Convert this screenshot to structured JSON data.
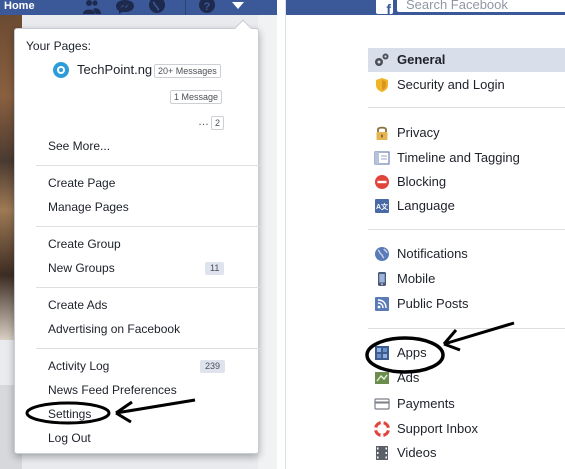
{
  "left": {
    "topbar": {
      "home_label": "Home"
    },
    "menu": {
      "your_pages_label": "Your Pages:",
      "page_name": "TechPoint.ng",
      "page_messages_badge": "20+ Messages",
      "second_badge": "1 Message",
      "ellipsis": "…",
      "third_badge": "2",
      "see_more": "See More...",
      "create_page": "Create Page",
      "manage_pages": "Manage Pages",
      "create_group": "Create Group",
      "new_groups": "New Groups",
      "new_groups_count": "11",
      "create_ads": "Create Ads",
      "advertising": "Advertising on Facebook",
      "activity_log": "Activity Log",
      "activity_log_count": "239",
      "news_feed_prefs": "News Feed Preferences",
      "settings": "Settings",
      "log_out": "Log Out"
    }
  },
  "right": {
    "search_placeholder": "Search Facebook",
    "fb_letter": "f",
    "nav": [
      {
        "label": "General",
        "icon": "gears-icon"
      },
      {
        "label": "Security and Login",
        "icon": "shield-icon"
      },
      {
        "label": "Privacy",
        "icon": "lock-icon"
      },
      {
        "label": "Timeline and Tagging",
        "icon": "timeline-icon"
      },
      {
        "label": "Blocking",
        "icon": "block-icon"
      },
      {
        "label": "Language",
        "icon": "language-icon"
      },
      {
        "label": "Notifications",
        "icon": "globe-icon"
      },
      {
        "label": "Mobile",
        "icon": "mobile-icon"
      },
      {
        "label": "Public Posts",
        "icon": "rss-icon"
      },
      {
        "label": "Apps",
        "icon": "apps-icon"
      },
      {
        "label": "Ads",
        "icon": "ads-icon"
      },
      {
        "label": "Payments",
        "icon": "card-icon"
      },
      {
        "label": "Support Inbox",
        "icon": "lifebuoy-icon"
      },
      {
        "label": "Videos",
        "icon": "film-icon"
      }
    ]
  },
  "colors": {
    "facebook_blue": "#3b5998",
    "active_bg": "#d8dfea"
  }
}
